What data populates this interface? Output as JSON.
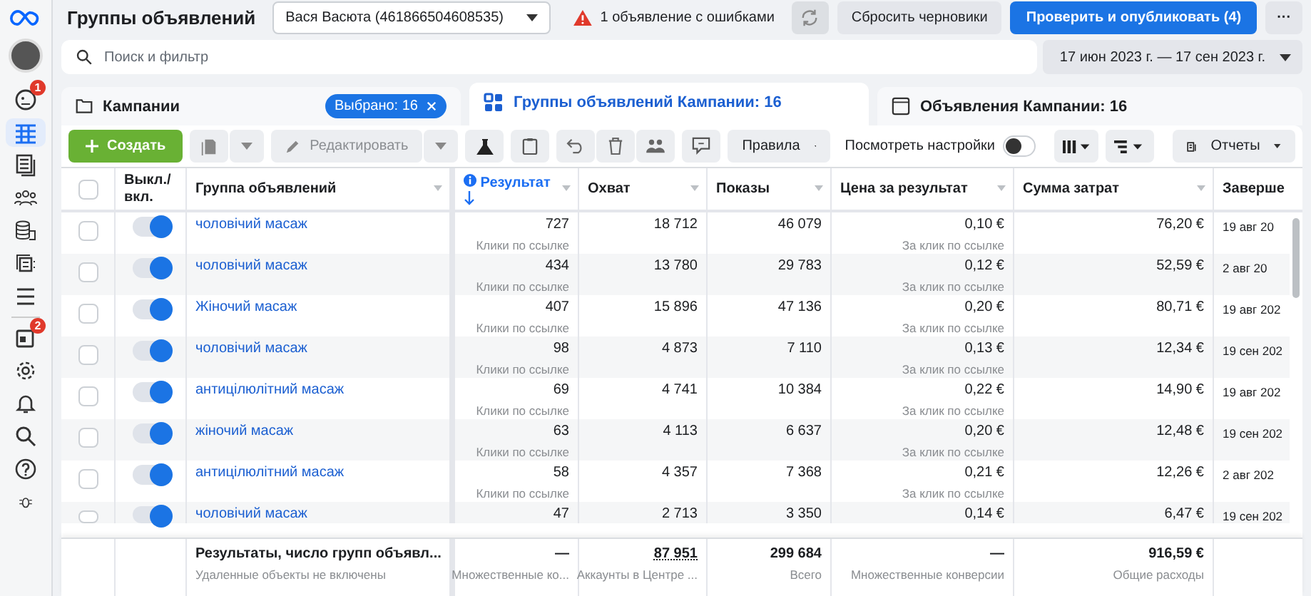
{
  "sidebar": {
    "items": [
      {
        "badge": "1",
        "selected": false
      },
      {
        "selected": true
      },
      {
        "selected": false
      },
      {
        "selected": false
      },
      {
        "selected": false
      },
      {
        "selected": false
      },
      {
        "selected": false
      },
      {
        "badge": "2",
        "selected": false
      },
      {
        "selected": false
      },
      {
        "selected": false
      },
      {
        "selected": false
      },
      {
        "selected": false
      },
      {
        "selected": false
      }
    ]
  },
  "header": {
    "title": "Группы объявлений",
    "account": "Вася Васюта (461866504608535)",
    "warning": "1 объявление с ошибками",
    "reset_button": "Сбросить черновики",
    "publish_button": "Проверить и опубликовать (4)",
    "more_button": "···"
  },
  "search": {
    "placeholder": "Поиск и фильтр",
    "date_range": "17 июн 2023 г. — 17 сен 2023 г."
  },
  "tabs": [
    {
      "kind": "campaigns",
      "label": "Кампании",
      "chip": "Выбрано: 16",
      "selected": false
    },
    {
      "kind": "adsets",
      "label": "Группы объявлений Кампании: 16",
      "selected": true
    },
    {
      "kind": "ads",
      "label": "Объявления Кампании: 16",
      "selected": false
    }
  ],
  "toolbar": {
    "create": "Создать",
    "edit": "Редактировать",
    "rules": "Правила",
    "view_settings": "Посмотреть настройки",
    "view_settings_on": false,
    "reports": "Отчеты"
  },
  "table": {
    "select_all_checked": false,
    "columns": [
      "Выкл./ вкл.",
      "Группа объявлений",
      "Результат",
      "Охват",
      "Показы",
      "Цена за результат",
      "Сумма затрат",
      "Заверше"
    ],
    "rows": [
      {
        "checked": false,
        "on": true,
        "name": "чоловічий масаж",
        "result": "727",
        "result_sub": "Клики по ссылке",
        "reach": "18 712",
        "impressions": "46 079",
        "cost": "0,10 €",
        "cost_sub": "За клик по ссылке",
        "spend": "76,20 €",
        "end": "19 авг 20"
      },
      {
        "checked": false,
        "on": true,
        "name": "чоловічий масаж",
        "result": "434",
        "result_sub": "Клики по ссылке",
        "reach": "13 780",
        "impressions": "29 783",
        "cost": "0,12 €",
        "cost_sub": "За клик по ссылке",
        "spend": "52,59 €",
        "end": "2 авг 20"
      },
      {
        "checked": false,
        "on": true,
        "name": "Жіночий масаж",
        "result": "407",
        "result_sub": "Клики по ссылке",
        "reach": "15 896",
        "impressions": "47 136",
        "cost": "0,20 €",
        "cost_sub": "За клик по ссылке",
        "spend": "80,71 €",
        "end": "19 авг 202"
      },
      {
        "checked": false,
        "on": true,
        "name": "чоловічий масаж",
        "result": "98",
        "result_sub": "Клики по ссылке",
        "reach": "4 873",
        "impressions": "7 110",
        "cost": "0,13 €",
        "cost_sub": "За клик по ссылке",
        "spend": "12,34 €",
        "end": "19 сен 202"
      },
      {
        "checked": false,
        "on": true,
        "name": "антицілюлітний масаж",
        "result": "69",
        "result_sub": "Клики по ссылке",
        "reach": "4 741",
        "impressions": "10 384",
        "cost": "0,22 €",
        "cost_sub": "За клик по ссылке",
        "spend": "14,90 €",
        "end": "19 авг 202"
      },
      {
        "checked": false,
        "on": true,
        "name": "жіночий масаж",
        "result": "63",
        "result_sub": "Клики по ссылке",
        "reach": "4 113",
        "impressions": "6 637",
        "cost": "0,20 €",
        "cost_sub": "За клик по ссылке",
        "spend": "12,48 €",
        "end": "19 сен 202"
      },
      {
        "checked": false,
        "on": true,
        "name": "антицілюлітний масаж",
        "result": "58",
        "result_sub": "Клики по ссылке",
        "reach": "4 357",
        "impressions": "7 368",
        "cost": "0,21 €",
        "cost_sub": "За клик по ссылке",
        "spend": "12,26 €",
        "end": "2 авг 202"
      },
      {
        "checked": false,
        "on": true,
        "name": "чоловічий масаж",
        "result": "47",
        "reach": "2 713",
        "impressions": "3 350",
        "cost": "0,14 €",
        "spend": "6,47 €",
        "end": "19 сен 202"
      }
    ],
    "footer": {
      "label": "Результаты, число групп объявл...",
      "label_sub": "Удаленные объекты не включены",
      "result": "—",
      "result_sub": "Множественные ко...",
      "reach": "87 951",
      "reach_sub": "Аккаунты в Центре ...",
      "impressions": "299 684",
      "impressions_sub": "Всего",
      "cost": "—",
      "cost_sub": "Множественные конверсии",
      "spend": "916,59 €",
      "spend_sub": "Общие расходы"
    }
  }
}
